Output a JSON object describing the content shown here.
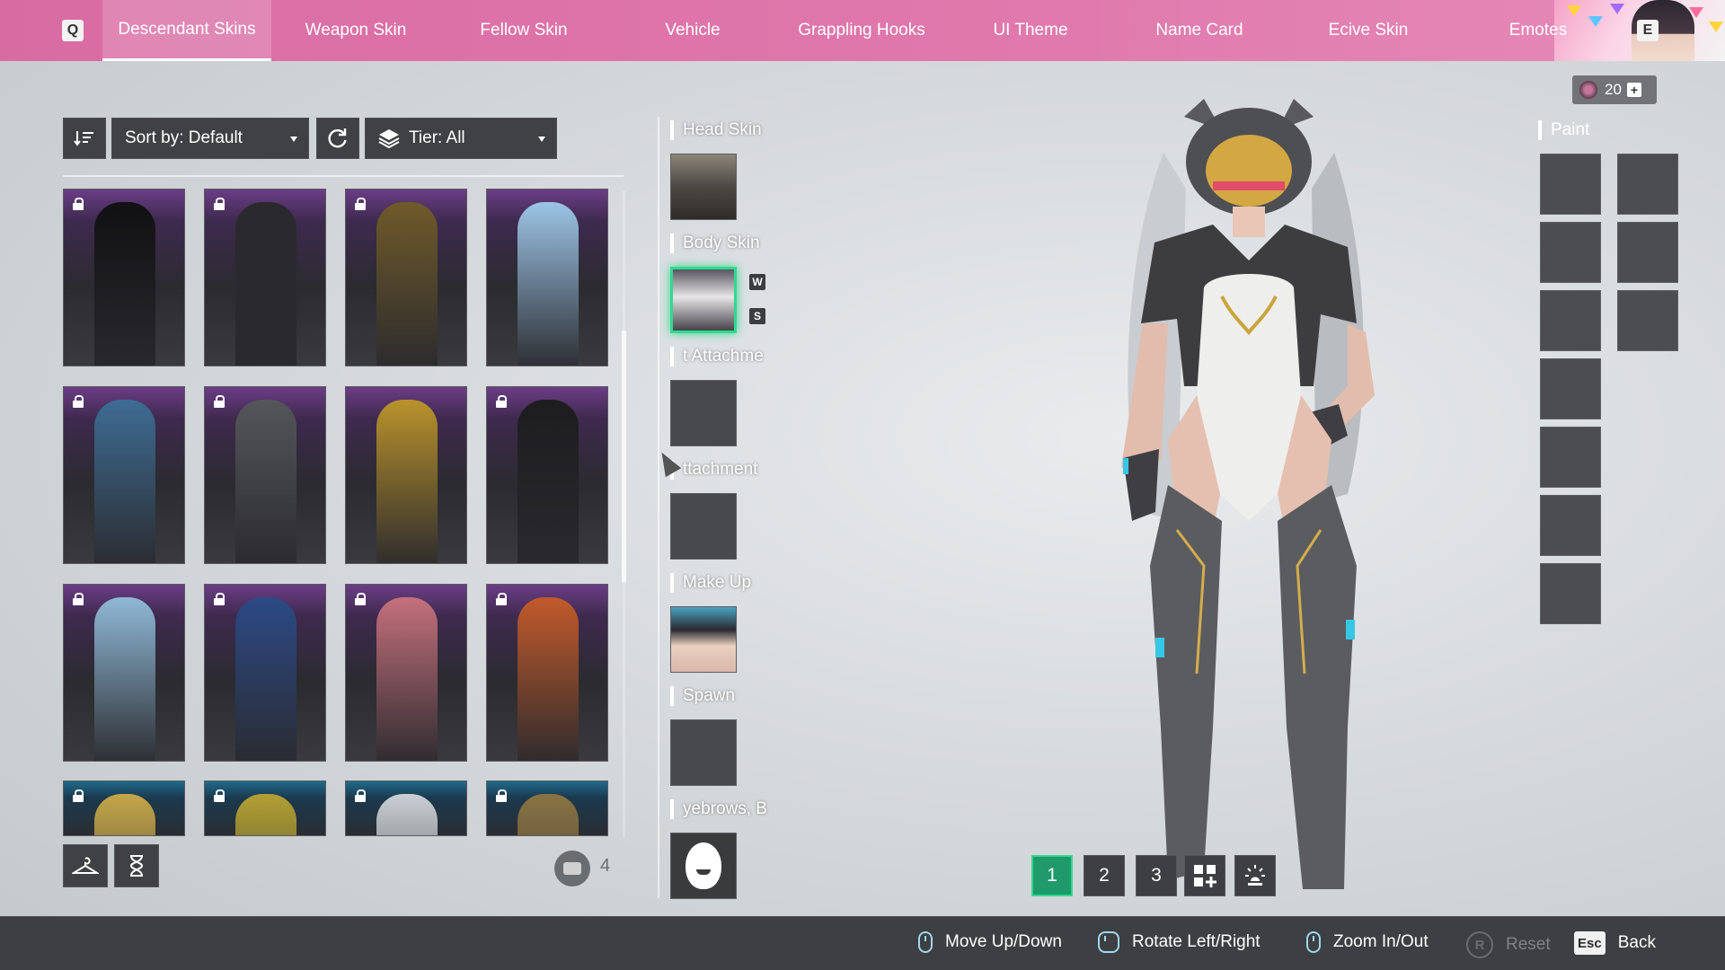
{
  "window": {
    "q_key": "Q",
    "e_key": "E"
  },
  "tabs": [
    {
      "label": "Descendant Skins",
      "active": true
    },
    {
      "label": "Weapon Skin",
      "active": false
    },
    {
      "label": "Fellow Skin",
      "active": false
    },
    {
      "label": "Vehicle",
      "active": false
    },
    {
      "label": "Grappling Hooks",
      "active": false
    },
    {
      "label": "UI Theme",
      "active": false
    },
    {
      "label": "Name Card",
      "active": false
    },
    {
      "label": "Ecive Skin",
      "active": false
    },
    {
      "label": "Emotes",
      "active": false
    }
  ],
  "filters": {
    "sort_label": "Sort by: Default",
    "tier_label": "Tier: All"
  },
  "skins_grid": {
    "items": [
      {
        "locked": true,
        "icon": "bunny-suit-skin",
        "accent": "#111114"
      },
      {
        "locked": true,
        "icon": "punk-leather-skin",
        "accent": "#2a2a2e"
      },
      {
        "locked": true,
        "icon": "gold-dress-skin",
        "accent": "#6f5a2a"
      },
      {
        "locked": false,
        "icon": "ice-armor-skin",
        "accent": "#9cc4e6"
      },
      {
        "locked": true,
        "icon": "school-uniform-skin",
        "accent": "#3e6c94"
      },
      {
        "locked": true,
        "icon": "office-suit-skin",
        "accent": "#55565a"
      },
      {
        "locked": false,
        "icon": "golden-armor-skin",
        "accent": "#b9922c"
      },
      {
        "locked": true,
        "icon": "black-bodysuit-skin",
        "accent": "#1d1d20"
      },
      {
        "locked": true,
        "icon": "bikini-skin",
        "accent": "#8fb8d6"
      },
      {
        "locked": true,
        "icon": "blue-tactical-skin",
        "accent": "#2c4a86"
      },
      {
        "locked": true,
        "icon": "pink-mecha-skin",
        "accent": "#c4707c"
      },
      {
        "locked": true,
        "icon": "orange-racer-skin",
        "accent": "#c25a2c"
      },
      {
        "locked": true,
        "icon": "yellow-bow-skin",
        "accent": "#c4a64a"
      },
      {
        "locked": true,
        "icon": "corn-costume-skin",
        "accent": "#b2a034"
      },
      {
        "locked": true,
        "icon": "white-hoodie-skin",
        "accent": "#c9cfd4"
      },
      {
        "locked": true,
        "icon": "gold-trim-skin",
        "accent": "#8a7444"
      }
    ],
    "owned_count": "4"
  },
  "slots": [
    {
      "label": "Head Skin",
      "kind": "head"
    },
    {
      "label": "Body Skin",
      "kind": "body",
      "tags": [
        "W",
        "S"
      ]
    },
    {
      "label": "t Attachme",
      "kind": "empty"
    },
    {
      "label": "ttachment",
      "kind": "empty"
    },
    {
      "label": "Make Up",
      "kind": "makeup"
    },
    {
      "label": "Spawn",
      "kind": "empty"
    },
    {
      "label": "yebrows, B",
      "kind": "face"
    }
  ],
  "currency": {
    "amount": "20",
    "plus": "+"
  },
  "paint": {
    "label": "Paint"
  },
  "view_buttons": [
    {
      "label": "1",
      "active": true
    },
    {
      "label": "2",
      "active": false
    },
    {
      "label": "3",
      "active": false
    }
  ],
  "hints": [
    {
      "label": "Move Up/Down",
      "key": "mouse"
    },
    {
      "label": "Rotate Left/Right",
      "key": "mouse"
    },
    {
      "label": "Zoom In/Out",
      "key": "mouse"
    },
    {
      "label": "Reset",
      "key": "R"
    },
    {
      "label": "Back",
      "key": "Esc"
    }
  ],
  "colors": {
    "topbar": "#dc70a7",
    "selection": "#30d98f",
    "panel": "#3f4144"
  }
}
